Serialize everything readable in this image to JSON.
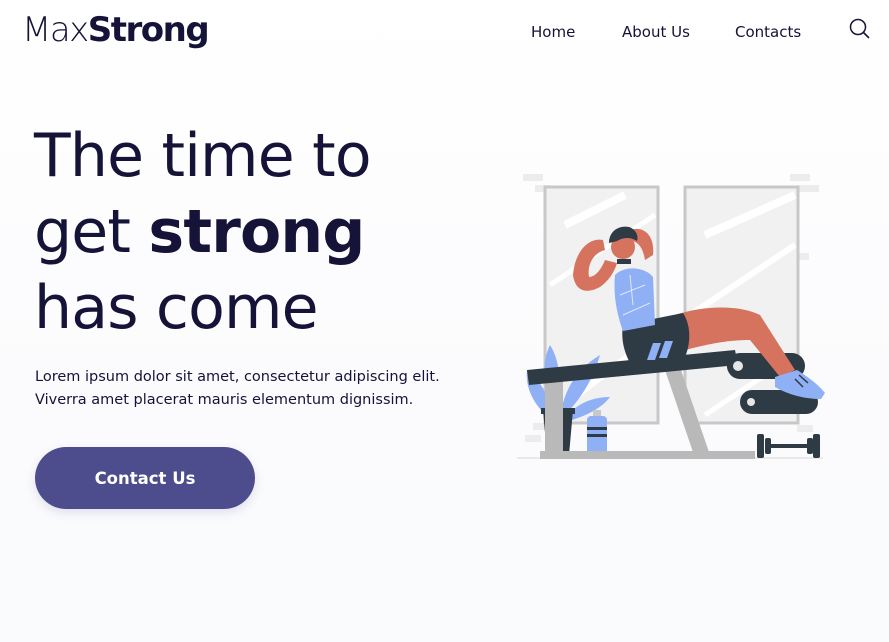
{
  "brand": {
    "logo_light": "Max",
    "logo_bold": "Strong"
  },
  "nav": {
    "items": [
      {
        "label": "Home"
      },
      {
        "label": "About Us"
      },
      {
        "label": "Contacts"
      }
    ],
    "search_icon": "search-icon"
  },
  "hero": {
    "title_line1": "The time to",
    "title_line2_prefix": "get ",
    "title_line2_bold": "strong",
    "title_line3": "has come",
    "description_line1": "Lorem ipsum dolor sit amet, consectetur adipiscing elit.",
    "description_line2": "Viverra amet placerat mauris elementum dignissim.",
    "cta_label": "Contact Us"
  },
  "illustration": {
    "icon": "workout-illustration",
    "colors": {
      "skin": "#d5735f",
      "accent_blue": "#8fb0f5",
      "dark": "#2e3a44",
      "frame_gray": "#c8c8c8",
      "mirror": "#ececec"
    }
  },
  "colors": {
    "text": "#151338",
    "cta_background": "#4d4d8d",
    "cta_text": "#ffffff"
  }
}
